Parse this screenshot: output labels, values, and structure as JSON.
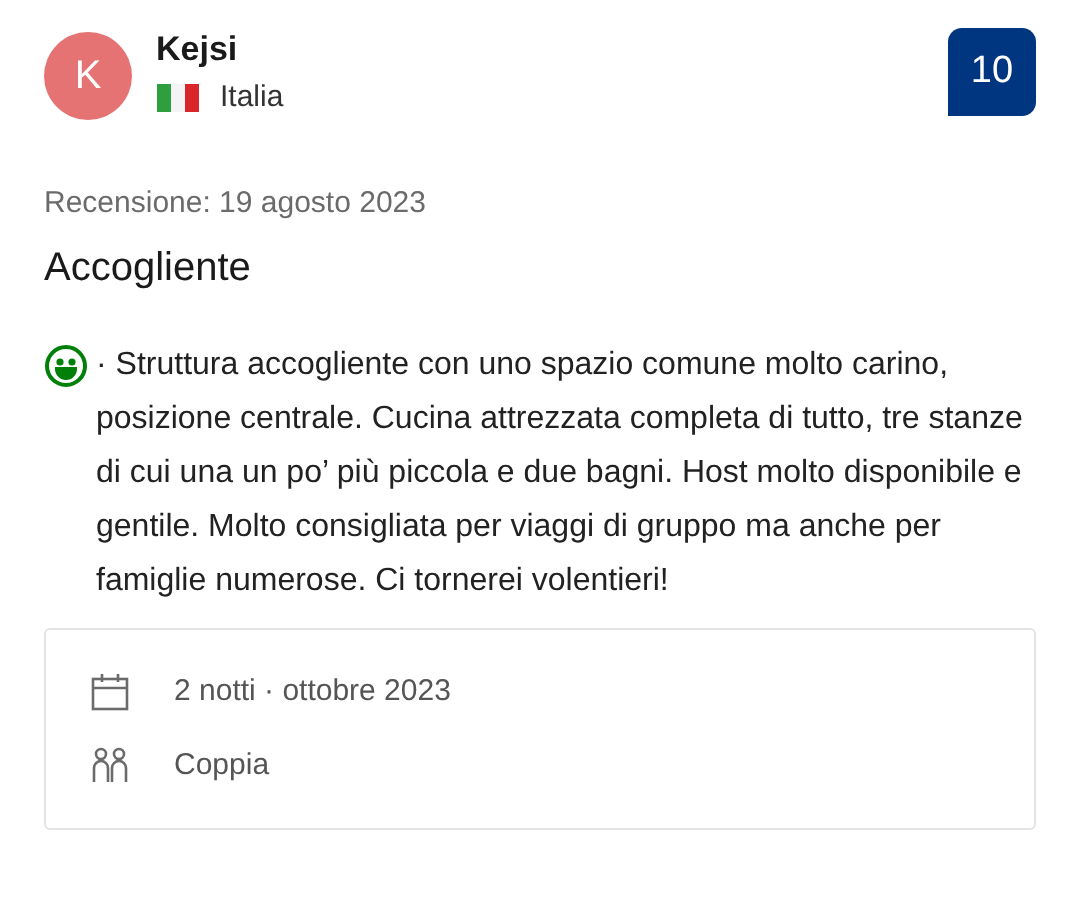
{
  "reviewer": {
    "initial": "K",
    "name": "Kejsi",
    "country": "Italia"
  },
  "score": "10",
  "review_date": "Recensione: 19 agosto 2023",
  "title": "Accogliente",
  "body": "· Struttura accogliente con uno spazio comune molto carino, posizione centrale. Cucina attrezzata completa di tutto, tre stanze di cui una un po’ più piccola e due bagni. Host molto disponibile e gentile. Molto consigliata per viaggi di gruppo ma anche per famiglie numerose. Ci tornerei volentieri!",
  "details": [
    {
      "kind": "stay",
      "text": "2 notti · ottobre 2023"
    },
    {
      "kind": "group",
      "text": "Coppia"
    }
  ]
}
